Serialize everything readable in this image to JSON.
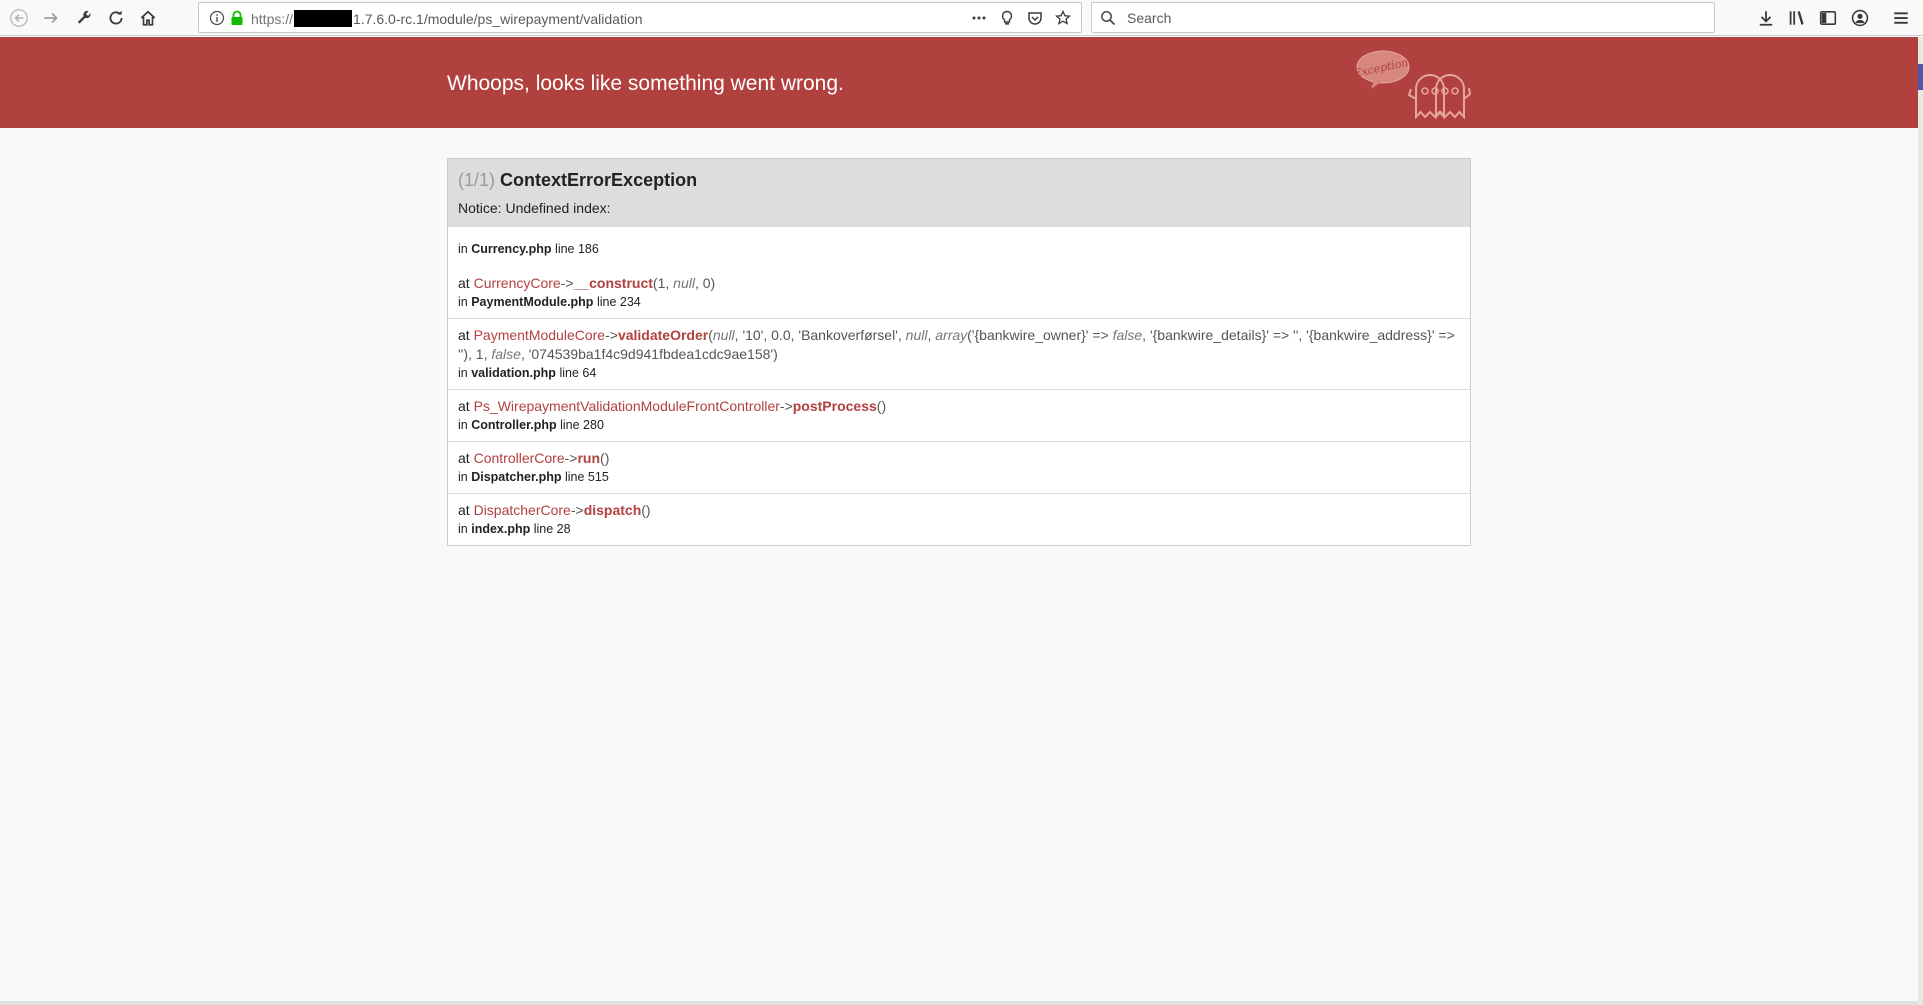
{
  "browser": {
    "url_scheme": "https://",
    "url_path": "1.7.6.0-rc.1/module/ps_wirepayment/validation",
    "search_placeholder": "Search",
    "page_actions_icon": "ellipsis-icon"
  },
  "error_page": {
    "header_title": "Whoops, looks like something went wrong.",
    "ghost_label": "Exception!",
    "exception_count": "(1/1)",
    "exception_class": "ContextErrorException",
    "message": "Notice: Undefined index:",
    "first_location": {
      "prefix": "in",
      "file": "Currency.php",
      "line": "line 186"
    },
    "trace": [
      {
        "at": "at",
        "class": "CurrencyCore",
        "arrow": "->",
        "method": "__construct",
        "args_html": "(1, <i>null</i>, 0)",
        "in": "in",
        "file": "PaymentModule.php",
        "line": "line 234"
      },
      {
        "at": "at",
        "class": "PaymentModuleCore",
        "arrow": "->",
        "method": "validateOrder",
        "args_html": "(<i>null</i>, '10', 0.0, 'Bankoverførsel', <i>null</i>, <i>array</i>('{bankwire_owner}' =&gt; <i>false</i>, '{bankwire_details}' =&gt; '', '{bankwire_address}' =&gt; ''), 1, <i>false</i>, '074539ba1f4c9d941fbdea1cdc9ae158')",
        "in": "in",
        "file": "validation.php",
        "line": "line 64"
      },
      {
        "at": "at",
        "class": "Ps_WirepaymentValidationModuleFrontController",
        "arrow": "->",
        "method": "postProcess",
        "args_html": "()",
        "in": "in",
        "file": "Controller.php",
        "line": "line 280"
      },
      {
        "at": "at",
        "class": "ControllerCore",
        "arrow": "->",
        "method": "run",
        "args_html": "()",
        "in": "in",
        "file": "Dispatcher.php",
        "line": "line 515"
      },
      {
        "at": "at",
        "class": "DispatcherCore",
        "arrow": "->",
        "method": "dispatch",
        "args_html": "()",
        "in": "in",
        "file": "index.php",
        "line": "line 28"
      }
    ]
  },
  "colors": {
    "header": "#b0413e",
    "class_name": "#b0413e",
    "box_head": "#dddddd"
  }
}
